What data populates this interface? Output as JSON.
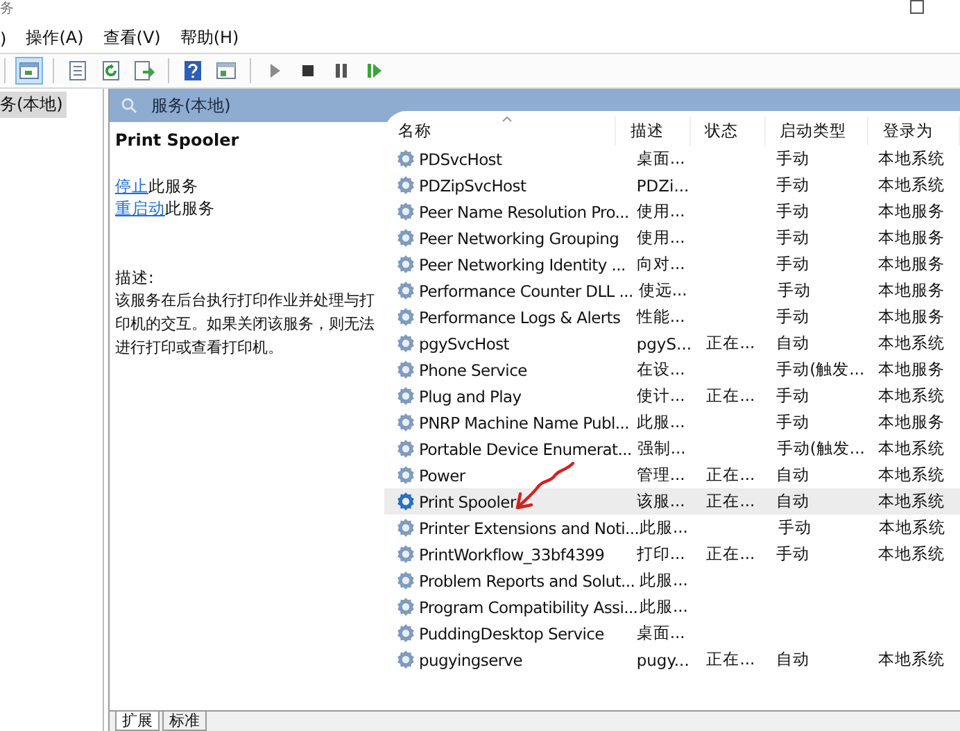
{
  "window": {
    "title": "务"
  },
  "menu": [
    ")",
    "操作(A)",
    "查看(V)",
    "帮助(H)"
  ],
  "toolbar": [
    {
      "kind": "separator"
    },
    {
      "kind": "view",
      "selected": true
    },
    {
      "kind": "separator"
    },
    {
      "kind": "properties",
      "selected": false
    },
    {
      "kind": "refresh",
      "selected": false
    },
    {
      "kind": "export",
      "selected": false
    },
    {
      "kind": "separator"
    },
    {
      "kind": "help",
      "selected": false
    },
    {
      "kind": "pane",
      "selected": false
    },
    {
      "kind": "separator"
    },
    {
      "kind": "play",
      "selected": false
    },
    {
      "kind": "stop",
      "selected": false
    },
    {
      "kind": "pause",
      "selected": false
    },
    {
      "kind": "resume",
      "selected": false
    }
  ],
  "tree": [
    {
      "label": "务(本地)",
      "selected": true
    }
  ],
  "pane_header": "服务(本地)",
  "detail": {
    "title": "Print Spooler",
    "actions": [
      {
        "link": "停止",
        "text": "此服务"
      },
      {
        "link": "重启动",
        "text": "此服务"
      }
    ],
    "description_label": "描述:",
    "description": "该服务在后台执行打印作业并处理与打印机的交互。如果关闭该服务，则无法进行打印或查看打印机。"
  },
  "table": {
    "columns": [
      "名称",
      "描述",
      "状态",
      "启动类型",
      "登录为"
    ],
    "rows": [
      {
        "name": "PDSvcHost",
        "description": "桌面...",
        "startup": "手动",
        "logon": "本地系统",
        "selected": false
      },
      {
        "name": "PDZipSvcHost",
        "description": "PDZi...",
        "startup": "手动",
        "logon": "本地系统",
        "selected": false
      },
      {
        "name": "Peer Name Resolution Pro...",
        "description": "使用...",
        "startup": "手动",
        "logon": "本地服务",
        "selected": false
      },
      {
        "name": "Peer Networking Grouping",
        "description": "使用...",
        "startup": "手动",
        "logon": "本地服务",
        "selected": false
      },
      {
        "name": "Peer Networking Identity ...",
        "description": "向对...",
        "startup": "手动",
        "logon": "本地服务",
        "selected": false
      },
      {
        "name": "Performance Counter DLL ...",
        "description": "使远...",
        "startup": "手动",
        "logon": "本地服务",
        "selected": false
      },
      {
        "name": "Performance Logs & Alerts",
        "description": "性能...",
        "startup": "手动",
        "logon": "本地服务",
        "selected": false
      },
      {
        "name": "pgySvcHost",
        "description": "pgyS...",
        "status": "正在...",
        "startup": "自动",
        "logon": "本地系统",
        "selected": false
      },
      {
        "name": "Phone Service",
        "description": "在设...",
        "startup": "手动(触发...",
        "logon": "本地服务",
        "selected": false
      },
      {
        "name": "Plug and Play",
        "description": "使计...",
        "status": "正在...",
        "startup": "手动",
        "logon": "本地系统",
        "selected": false
      },
      {
        "name": "PNRP Machine Name Publ...",
        "description": "此服...",
        "startup": "手动",
        "logon": "本地服务",
        "selected": false
      },
      {
        "name": "Portable Device Enumerat...",
        "description": "强制...",
        "startup": "手动(触发...",
        "logon": "本地系统",
        "selected": false
      },
      {
        "name": "Power",
        "description": "管理...",
        "status": "正在...",
        "startup": "自动",
        "logon": "本地系统",
        "selected": false
      },
      {
        "name": "Print Spooler",
        "description": "该服...",
        "status": "正在...",
        "startup": "自动",
        "logon": "本地系统",
        "selected": true
      },
      {
        "name": "Printer Extensions and Noti...",
        "description": "此服...",
        "startup": "手动",
        "logon": "本地系统",
        "selected": false
      },
      {
        "name": "PrintWorkflow_33bf4399",
        "description": "打印...",
        "status": "正在...",
        "startup": "手动",
        "logon": "本地系统",
        "selected": false
      },
      {
        "name": "Problem Reports and Solut...",
        "description": "此服...",
        "selected": false
      },
      {
        "name": "Program Compatibility Assi...",
        "description": "此服...",
        "selected": false
      },
      {
        "name": "PuddingDesktop Service",
        "description": "桌面...",
        "selected": false
      },
      {
        "name": "pugyingserve",
        "description": "pugy...",
        "status": "正在...",
        "startup": "自动",
        "logon": "本地系统",
        "selected": false
      }
    ]
  },
  "tabs": [
    {
      "label": "扩展",
      "selected": true
    },
    {
      "label": "标准",
      "selected": false
    }
  ]
}
